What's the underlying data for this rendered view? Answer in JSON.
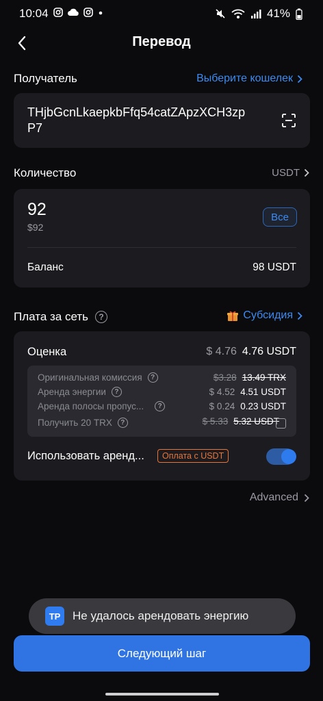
{
  "status_bar": {
    "time": "10:04",
    "battery": "41%"
  },
  "header": {
    "title": "Перевод"
  },
  "recipient": {
    "label": "Получатель",
    "select_wallet": "Выберите кошелек",
    "address": "THjbGcnLkaepkbFfq54catZApzXCH3zpP7"
  },
  "amount": {
    "label": "Количество",
    "token": "USDT",
    "value": "92",
    "fiat": "$92",
    "all_button": "Все",
    "balance_label": "Баланс",
    "balance_value": "98 USDT"
  },
  "fee": {
    "label": "Плата за сеть",
    "subsidy": "Субсидия",
    "estimate_label": "Оценка",
    "estimate_fiat": "$ 4.76",
    "estimate_value": "4.76 USDT",
    "rows": [
      {
        "label": "Оригинальная комиссия",
        "old": "$3.28",
        "value": "13.49 TRX"
      },
      {
        "label": "Аренда энергии",
        "old": "$ 4.52",
        "value": "4.51 USDT"
      },
      {
        "label": "Аренда полосы пропус...",
        "old": "$ 0.24",
        "value": "0.23 USDT"
      },
      {
        "label": "Получить 20 TRX",
        "old": "$ 5.33",
        "value": "5.32 USDT"
      }
    ],
    "rent_label": "Использовать аренд...",
    "rent_badge": "Оплата с USDT",
    "rent_enabled": true
  },
  "advanced": "Advanced",
  "toast": {
    "logo": "TP",
    "message": "Не удалось арендовать энергию"
  },
  "next_button": "Следующий шаг",
  "colors": {
    "accent": "#2f74e2",
    "link": "#3d8bf2",
    "warning": "#e8753a",
    "card": "#1c1c20"
  }
}
